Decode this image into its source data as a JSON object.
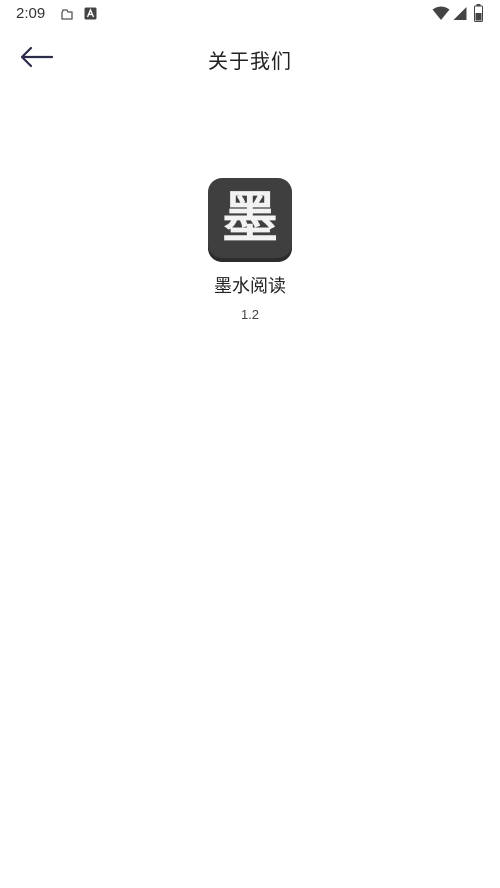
{
  "status_bar": {
    "time": "2:09",
    "left_icons": [
      "cloud-icon",
      "a-app-icon"
    ],
    "right_icons": [
      "wifi-icon",
      "signal-icon",
      "battery-icon"
    ]
  },
  "top_bar": {
    "back_icon": "back-arrow-icon",
    "title": "关于我们"
  },
  "app": {
    "logo_glyph": "墨",
    "name": "墨水阅读",
    "version": "1.2"
  }
}
